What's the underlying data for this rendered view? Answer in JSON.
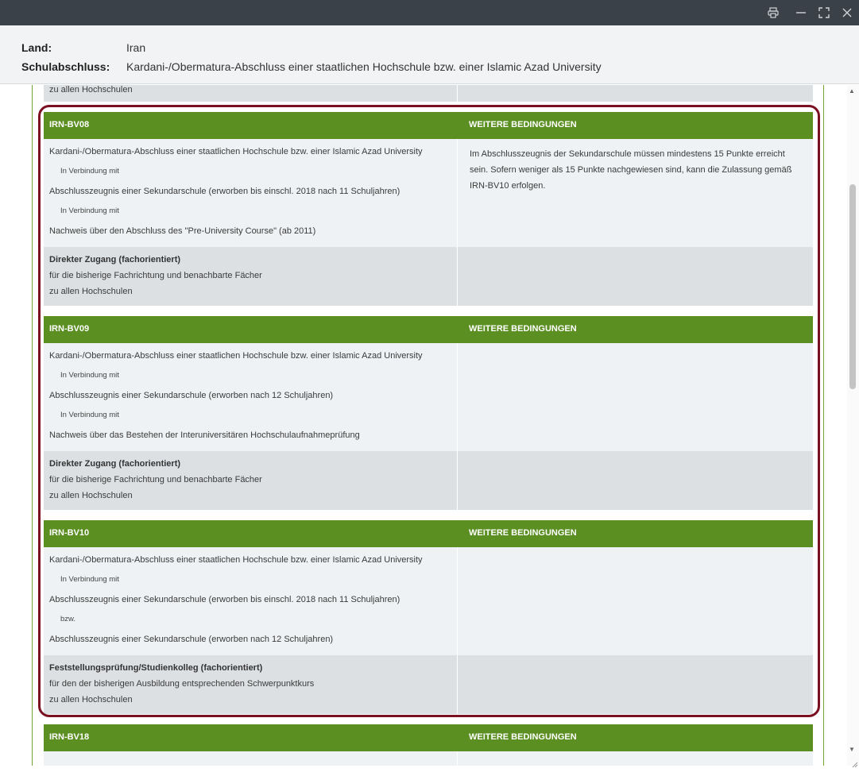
{
  "window": {
    "print_icon": "print-icon",
    "minimize_icon": "minimize-icon",
    "maximize_icon": "maximize-icon",
    "close_icon": "close-icon"
  },
  "header": {
    "land_label": "Land:",
    "land_value": "Iran",
    "schulabschluss_label": "Schulabschluss:",
    "schulabschluss_value": "Kardani-/Obermatura-Abschluss einer staatlichen Hochschule bzw. einer Islamic Azad University"
  },
  "top_partial": {
    "text": "zu allen Hochschulen"
  },
  "blocks": [
    {
      "code": "IRN-BV08",
      "heading_right": "WEITERE BEDINGUNGEN",
      "lines": [
        "Kardani-/Obermatura-Abschluss einer staatlichen Hochschule bzw. einer Islamic Azad University",
        "In Verbindung mit",
        "Abschlusszeugnis einer Sekundarschule (erworben bis einschl. 2018 nach 11 Schuljahren)",
        "In Verbindung mit",
        "Nachweis über den Abschluss des \"Pre-University Course\" (ab 2011)"
      ],
      "conditions": "Im Abschlusszeugnis der Sekundarschule müssen mindestens 15 Punkte erreicht sein. Sofern weniger als 15 Punkte nachgewiesen sind, kann die Zulassung gemäß IRN-BV10 erfolgen.",
      "access_title": "Direkter Zugang (fachorientiert)",
      "access_line1": "für die bisherige Fachrichtung und benachbarte Fächer",
      "access_line2": "zu allen Hochschulen"
    },
    {
      "code": "IRN-BV09",
      "heading_right": "WEITERE BEDINGUNGEN",
      "lines": [
        "Kardani-/Obermatura-Abschluss einer staatlichen Hochschule bzw. einer Islamic Azad University",
        "In Verbindung mit",
        "Abschlusszeugnis einer Sekundarschule (erworben nach 12 Schuljahren)",
        "In Verbindung mit",
        "Nachweis über das Bestehen der Interuniversitären Hochschulaufnahmeprüfung"
      ],
      "conditions": "",
      "access_title": "Direkter Zugang (fachorientiert)",
      "access_line1": "für die bisherige Fachrichtung und benachbarte Fächer",
      "access_line2": "zu allen Hochschulen"
    },
    {
      "code": "IRN-BV10",
      "heading_right": "WEITERE BEDINGUNGEN",
      "lines": [
        "Kardani-/Obermatura-Abschluss einer staatlichen Hochschule bzw. einer Islamic Azad University",
        "In Verbindung mit",
        "Abschlusszeugnis einer Sekundarschule (erworben bis einschl. 2018 nach 11 Schuljahren)",
        "bzw.",
        "Abschlusszeugnis einer Sekundarschule (erworben nach 12 Schuljahren)"
      ],
      "conditions": "",
      "access_title": "Feststellungsprüfung/Studienkolleg (fachorientiert)",
      "access_line1": "für den der bisherigen Ausbildung entsprechenden Schwerpunktkurs",
      "access_line2": "zu allen Hochschulen"
    },
    {
      "code": "IRN-BV18",
      "heading_right": "WEITERE BEDINGUNGEN"
    }
  ]
}
